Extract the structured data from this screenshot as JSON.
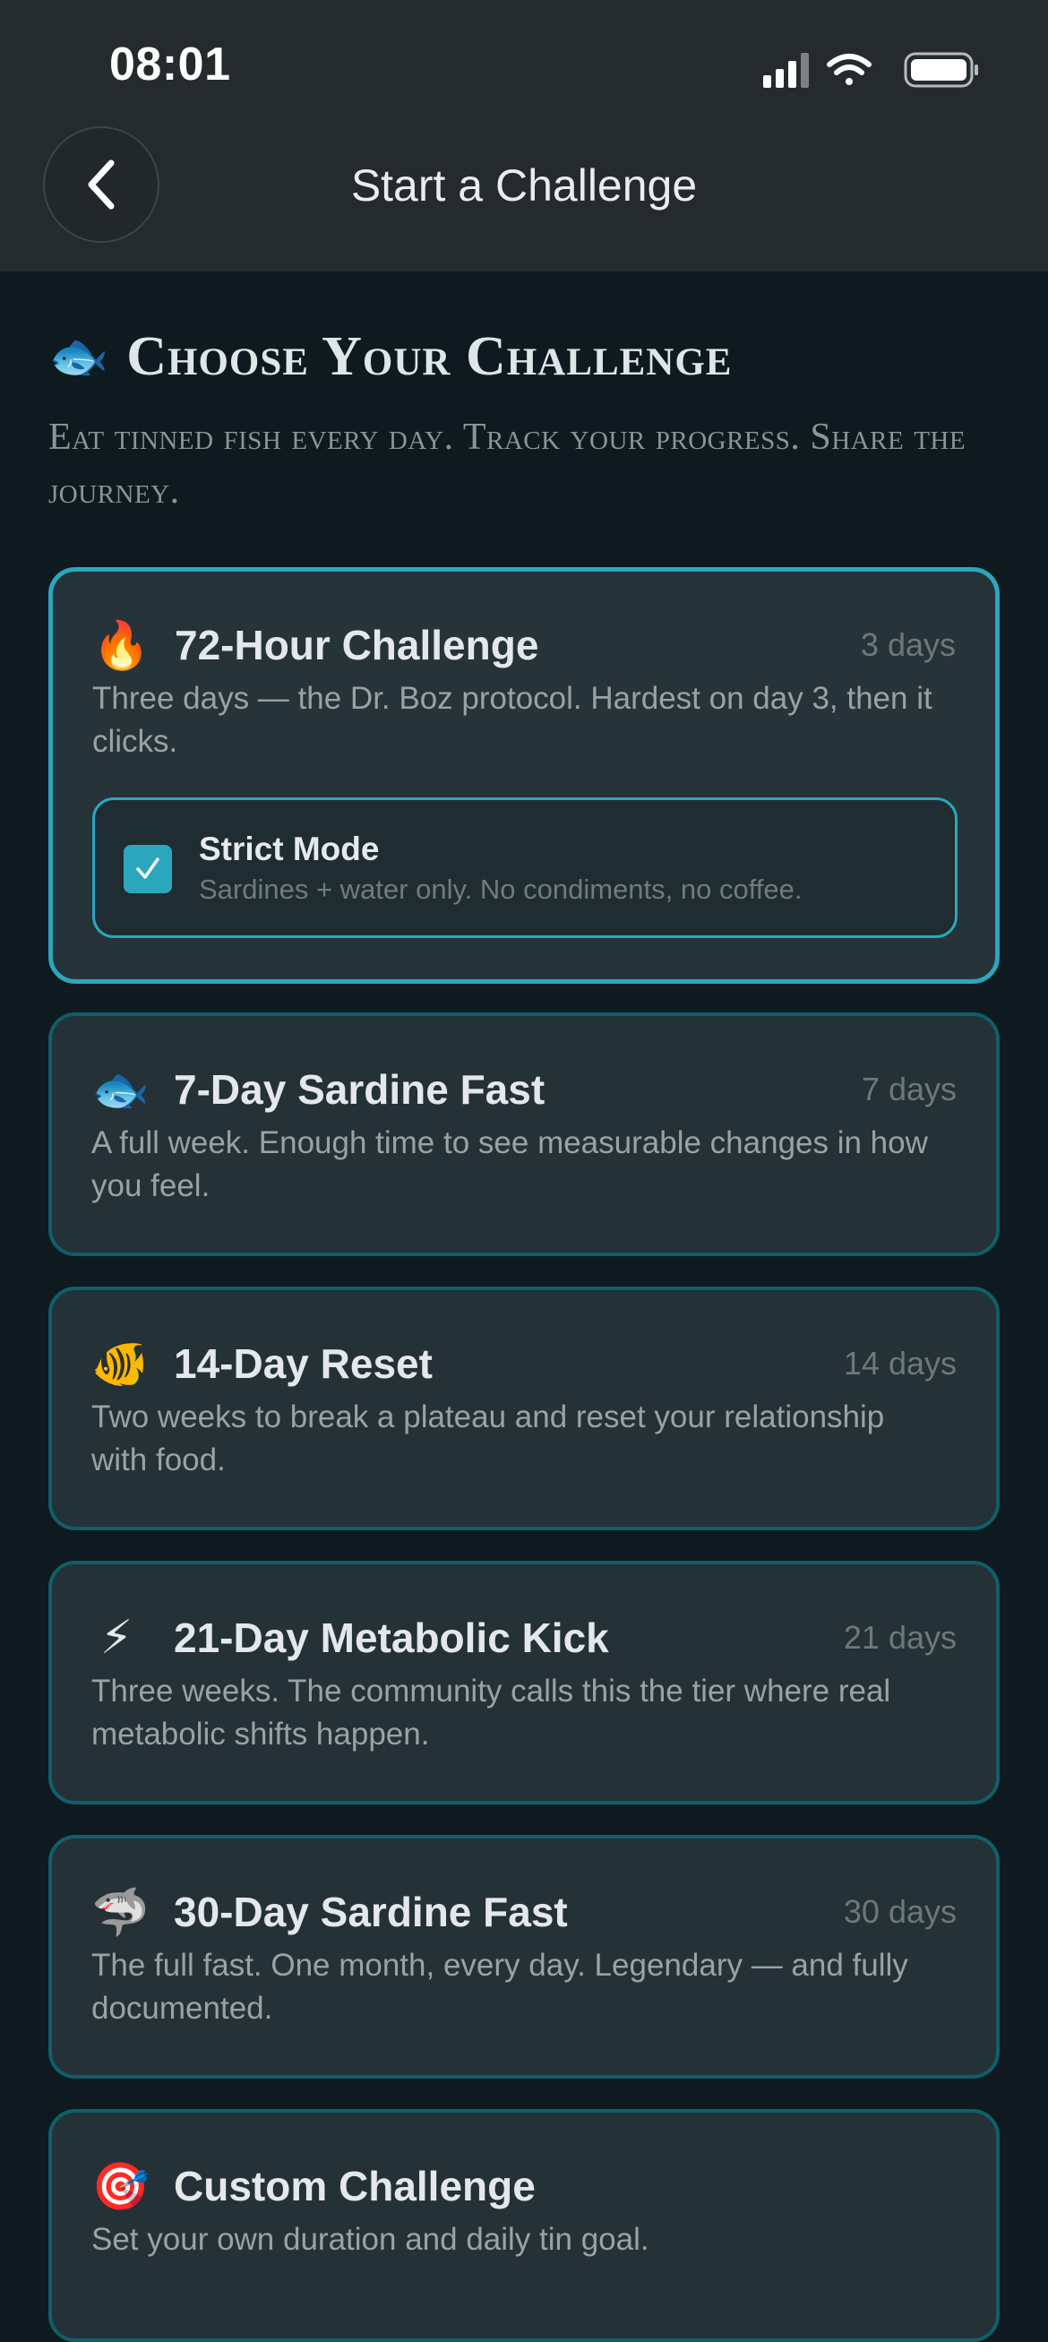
{
  "status": {
    "time": "08:01"
  },
  "nav": {
    "title": "Start a Challenge"
  },
  "header": {
    "emoji": "🐟",
    "title": "Choose Your Challenge",
    "subtitle": "Eat tinned fish every day. Track your progress. Share the journey."
  },
  "challenges": [
    {
      "emoji": "🔥",
      "title": "72-Hour Challenge",
      "days": "3 days",
      "description": "Three days — the Dr. Boz protocol. Hardest on day 3, then it clicks.",
      "selected": true
    },
    {
      "emoji": "🐟",
      "title": "7-Day Sardine Fast",
      "days": "7 days",
      "description": "A full week. Enough time to see measurable changes in how you feel."
    },
    {
      "emoji": "🐠",
      "title": "14-Day Reset",
      "days": "14 days",
      "description": "Two weeks to break a plateau and reset your relationship with food."
    },
    {
      "emoji": "⚡",
      "title": "21-Day Metabolic Kick",
      "days": "21 days",
      "description": "Three weeks. The community calls this the tier where real metabolic shifts happen."
    },
    {
      "emoji": "🦈",
      "title": "30-Day Sardine Fast",
      "days": "30 days",
      "description": "The full fast. One month, every day. Legendary — and fully documented."
    },
    {
      "emoji": "🎯",
      "title": "Custom Challenge",
      "days": "",
      "description": "Set your own duration and daily tin goal."
    }
  ],
  "strict_mode": {
    "label": "Strict Mode",
    "description": "Sardines + water only. No condiments, no coffee.",
    "checked": true
  },
  "colors": {
    "accent": "#2ba7bd",
    "card_border": "#0f5f6a",
    "background": "#0e1a1f"
  }
}
